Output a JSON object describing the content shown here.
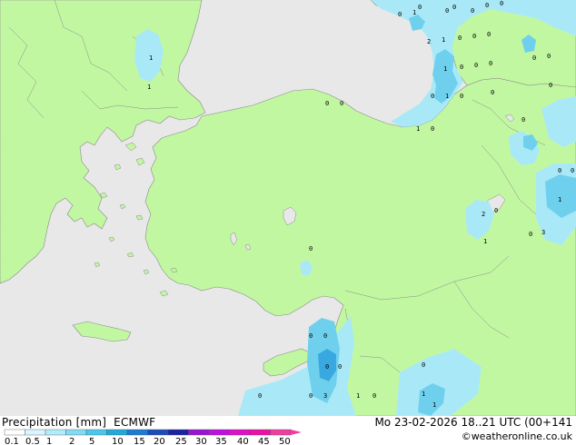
{
  "title": {
    "product": "Precipitation [mm]",
    "model": "ECMWF",
    "validity": "Mo 23-02-2026 18..21 UTC (00+141",
    "credit": "©weatheronline.co.uk"
  },
  "legend": {
    "labels": [
      "0.1",
      "0.5",
      "1",
      "2",
      "5",
      "10",
      "15",
      "20",
      "25",
      "30",
      "35",
      "40",
      "45",
      "50"
    ],
    "colors": [
      "#ffffff",
      "#d9f5ff",
      "#b0ecfc",
      "#80dcf5",
      "#48c8ec",
      "#1fa9dc",
      "#1c7bd2",
      "#1a4dbb",
      "#1a22a6",
      "#9913d6",
      "#c00fe0",
      "#e00fc9",
      "#ee0fa6",
      "#f23ca0"
    ]
  },
  "colors": {
    "land": "#c2f7a2",
    "sea": "#e8e8e8",
    "coast": "#8a8a8a",
    "precip_light": "#a9e9f7",
    "precip_mid": "#6fd0ee",
    "precip_heavy": "#3aa8e0"
  },
  "map_labels": [
    {
      "text": "0"
    },
    {
      "text": "1"
    },
    {
      "text": "0"
    },
    {
      "text": "0"
    },
    {
      "text": "0"
    },
    {
      "text": "0"
    },
    {
      "text": "2"
    },
    {
      "text": "1"
    },
    {
      "text": "0"
    },
    {
      "text": "0"
    },
    {
      "text": "0"
    },
    {
      "text": "0"
    },
    {
      "text": "1"
    },
    {
      "text": "0"
    },
    {
      "text": "0"
    },
    {
      "text": "0"
    },
    {
      "text": "0"
    },
    {
      "text": "1"
    },
    {
      "text": "1"
    },
    {
      "text": "1"
    },
    {
      "text": "0"
    },
    {
      "text": "0"
    },
    {
      "text": "0"
    },
    {
      "text": "1"
    },
    {
      "text": "0"
    },
    {
      "text": "0"
    },
    {
      "text": "0"
    },
    {
      "text": "0"
    },
    {
      "text": "0"
    },
    {
      "text": "0"
    },
    {
      "text": "0"
    },
    {
      "text": "0"
    },
    {
      "text": "2"
    },
    {
      "text": "1"
    },
    {
      "text": "0"
    },
    {
      "text": "1"
    },
    {
      "text": "3"
    },
    {
      "text": "0"
    },
    {
      "text": "0"
    },
    {
      "text": "0"
    },
    {
      "text": "0"
    },
    {
      "text": "0"
    },
    {
      "text": "0"
    },
    {
      "text": "0"
    },
    {
      "text": "3"
    },
    {
      "text": "1"
    },
    {
      "text": "0"
    },
    {
      "text": "0"
    },
    {
      "text": "1"
    },
    {
      "text": "1"
    },
    {
      "text": "0"
    },
    {
      "text": "0"
    }
  ]
}
